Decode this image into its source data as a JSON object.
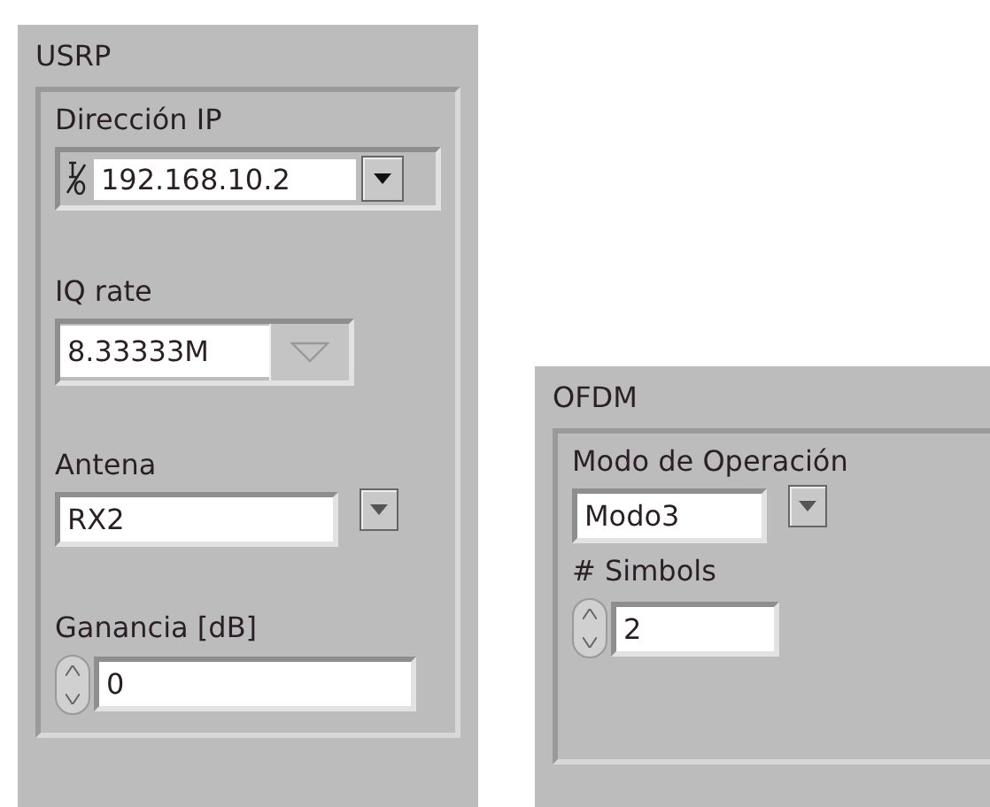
{
  "clusters": [
    {
      "title": "USRP",
      "controls": [
        {
          "kind": "io_combo",
          "label": "Dirección IP",
          "value": "192.168.10.2"
        },
        {
          "kind": "ring",
          "label": "IQ rate",
          "value": "8.33333M"
        },
        {
          "kind": "enum",
          "label": "Antena",
          "value": "RX2"
        },
        {
          "kind": "numeric",
          "label": "Ganancia [dB]",
          "value": "0"
        }
      ]
    },
    {
      "title": "OFDM",
      "controls": [
        {
          "kind": "enum",
          "label": "Modo de Operación",
          "value": "Modo3"
        },
        {
          "kind": "numeric",
          "label": "# Simbols",
          "value": "2"
        }
      ]
    }
  ]
}
